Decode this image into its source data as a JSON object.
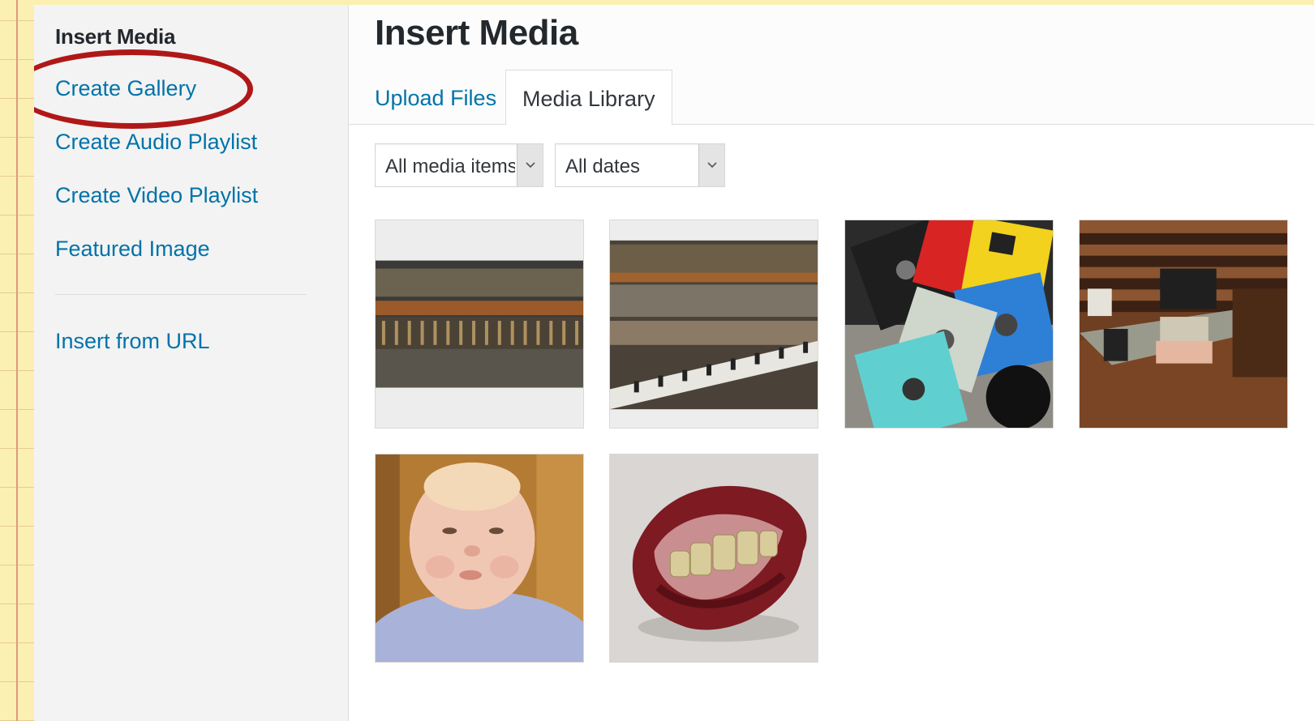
{
  "sidebar": {
    "title": "Insert Media",
    "links": {
      "create_gallery": "Create Gallery",
      "create_audio_playlist": "Create Audio Playlist",
      "create_video_playlist": "Create Video Playlist",
      "featured_image": "Featured Image",
      "insert_from_url": "Insert from URL"
    }
  },
  "main": {
    "title": "Insert Media",
    "tabs": [
      "Upload Files",
      "Media Library"
    ],
    "active_tab": "Media Library",
    "filters": {
      "media_type": "All media items",
      "date": "All dates"
    },
    "media_items": [
      {
        "subject": "piano-hammers-closeup"
      },
      {
        "subject": "old-piano-keyboard"
      },
      {
        "subject": "colorful-floppy-disks"
      },
      {
        "subject": "antique-desk-with-typewriter"
      },
      {
        "subject": "baby-portrait"
      },
      {
        "subject": "novelty-wax-lips-teeth"
      }
    ]
  },
  "annotation": {
    "color": "#b01818",
    "target": "create-gallery-link"
  },
  "colors": {
    "link": "#0073aa",
    "text": "#23282d",
    "sidebar_bg": "#f3f3f3",
    "page_bg": "#fbf0b2"
  }
}
